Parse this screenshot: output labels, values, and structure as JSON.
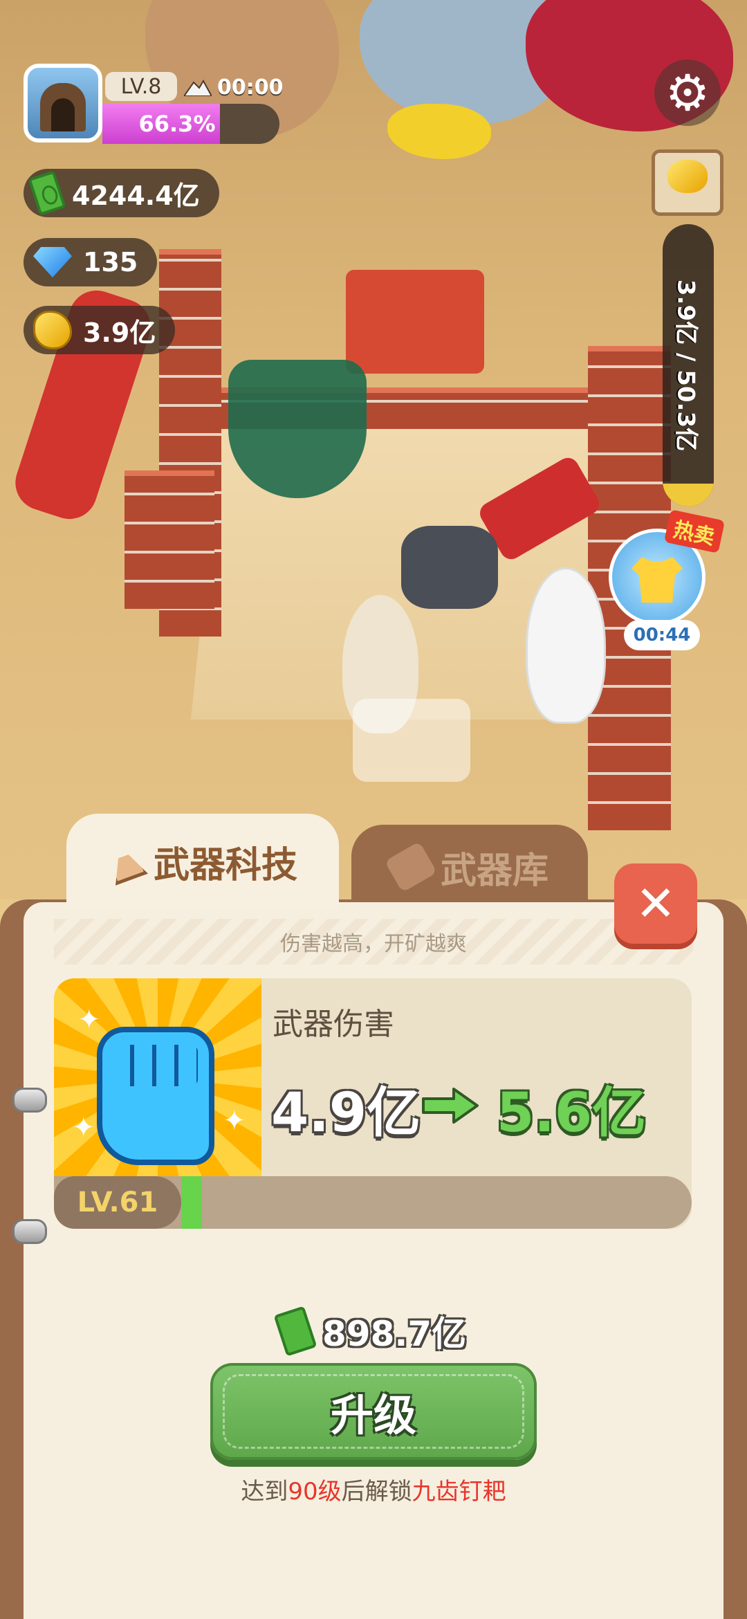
{
  "hud": {
    "level": "LV.8",
    "timer": "00:00",
    "progress_text": "66.3%",
    "progress_fraction": 0.663,
    "cash": "4244.4亿",
    "gems": "135",
    "gold": "3.9亿",
    "gold_capacity": "3.9亿 / 50.3亿",
    "gold_capacity_fraction": 0.08,
    "hot_sale_tag": "热卖",
    "hot_sale_timer": "00:44",
    "icons": {
      "settings": "gear-icon",
      "mountain": "mountain-icon",
      "cash": "cash-icon",
      "gem": "diamond-icon",
      "gold": "gold-nugget-icon"
    }
  },
  "panel": {
    "tab_tech": "武器科技",
    "tab_armory": "武器库",
    "subtitle": "伤害越高，开矿越爽",
    "close": "✕",
    "stat_name": "武器伤害",
    "stat_from": "4.9亿",
    "stat_to": "5.6亿",
    "level_label": "LV.61",
    "level_progress": 0.04,
    "cost": "898.7亿",
    "upgrade_label": "升级",
    "unlock_prefix": "达到",
    "unlock_level": "90级",
    "unlock_middle": "后解锁",
    "unlock_item": "九齿钉耙"
  },
  "colors": {
    "accent_green": "#67d44c",
    "progress_pink": "#e35ee0",
    "close_red": "#e8644e",
    "highlight_red": "#e8352b",
    "panel_bg": "#f6efdf",
    "frame_brown": "#9a6b4a"
  }
}
